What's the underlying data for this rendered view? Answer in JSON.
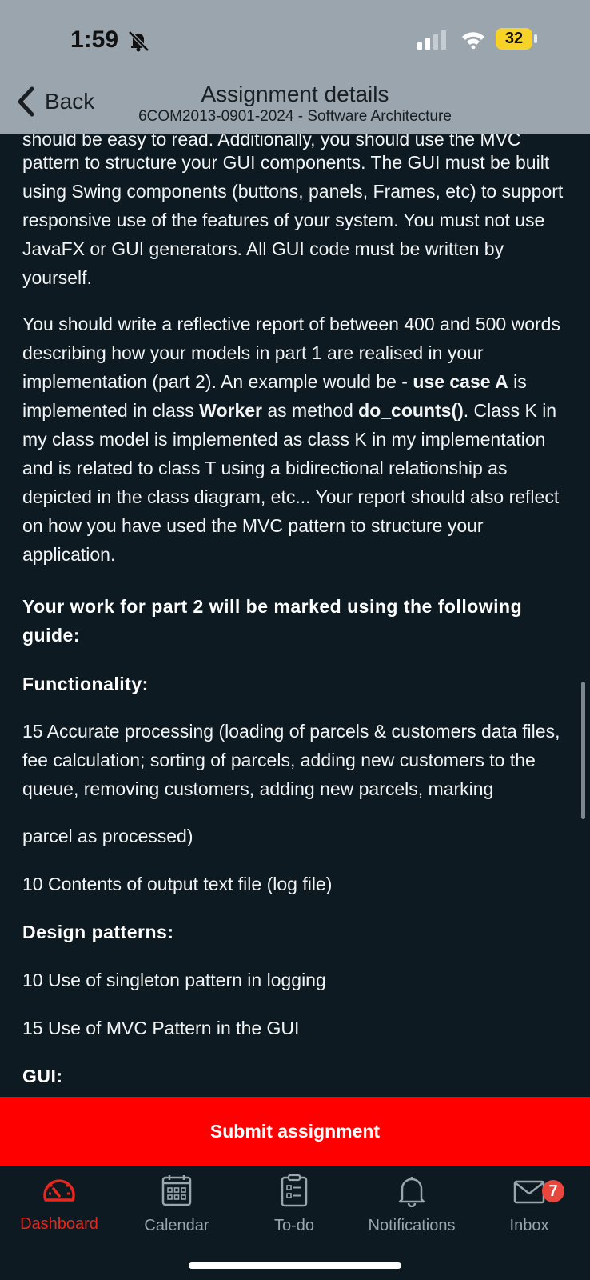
{
  "status_bar": {
    "time": "1:59",
    "battery": "32"
  },
  "header": {
    "back_label": "Back",
    "title": "Assignment details",
    "subtitle": "6COM2013-0901-2024 - Software Architecture"
  },
  "content": {
    "cut_line": "should be easy to read. Additionally, you should use the MVC",
    "para1": "pattern to structure your GUI components. The GUI must be built using Swing components (buttons, panels, Frames, etc) to support responsive use of the features of your system. You must not use JavaFX or GUI generators. All GUI code must be written by yourself.",
    "para2_a": "You should write a reflective report of between 400 and 500 words describing how your models in part 1 are realised in your implementation (part 2). An example would be - ",
    "para2_b": "use case A",
    "para2_c": " is implemented in class ",
    "para2_d": "Worker",
    "para2_e": " as method ",
    "para2_f": "do_counts()",
    "para2_g": ". Class K in my class model is implemented as class K in my implementation and is related to class T using a bidirectional relationship as depicted in the class diagram, etc... Your report should also reflect on how you have used the MVC pattern to structure your application.",
    "heading_guide": "Your work for part 2 will be marked using the following guide:",
    "heading_functionality": "Functionality:",
    "func_item1": "15 Accurate processing (loading of parcels & customers data files, fee calculation; sorting of parcels, adding new customers to the queue, removing customers, adding new parcels, marking",
    "func_item1_cont": "parcel as processed)",
    "func_item2": "10 Contents of output text file (log file)",
    "heading_design": "Design patterns:",
    "design_item1": "10 Use of singleton pattern in logging",
    "design_item2": "15 Use of MVC Pattern in the GUI",
    "heading_gui": "GUI:"
  },
  "submit_label": "Submit assignment",
  "tabs": [
    {
      "label": "Dashboard",
      "icon": "speedometer-icon",
      "active": true
    },
    {
      "label": "Calendar",
      "icon": "calendar-icon",
      "active": false
    },
    {
      "label": "To-do",
      "icon": "clipboard-icon",
      "active": false
    },
    {
      "label": "Notifications",
      "icon": "bell-icon",
      "active": false
    },
    {
      "label": "Inbox",
      "icon": "envelope-icon",
      "active": false,
      "badge": "7"
    }
  ],
  "colors": {
    "accent": "#ff0000",
    "header_bg": "#9aa5ad",
    "page_bg": "#0d1a21",
    "battery": "#f7d32a"
  }
}
